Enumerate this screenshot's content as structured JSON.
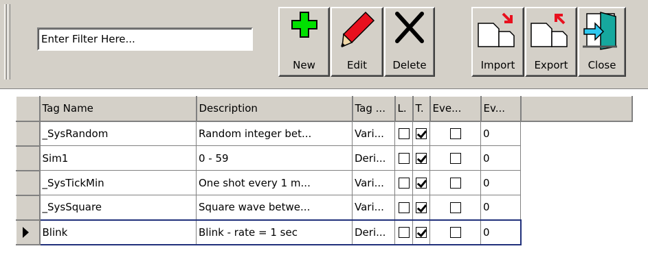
{
  "toolbar": {
    "filter_placeholder": "Enter Filter Here...",
    "buttons": [
      {
        "label": "New",
        "icon": "plus-icon"
      },
      {
        "label": "Edit",
        "icon": "pencil-icon"
      },
      {
        "label": "Delete",
        "icon": "x-icon"
      },
      {
        "label": "Import",
        "icon": "import-icon"
      },
      {
        "label": "Export",
        "icon": "export-icon"
      },
      {
        "label": "Close",
        "icon": "door-icon"
      }
    ]
  },
  "grid": {
    "columns": [
      "Tag Name",
      "Description",
      "Tag ...",
      "L.",
      "T.",
      "Eve...",
      "Ev..."
    ],
    "rows": [
      {
        "name": "_SysRandom",
        "description": "Random integer bet...",
        "tag": "Vari...",
        "l": false,
        "t": true,
        "eve": false,
        "ev": "0"
      },
      {
        "name": "Sim1",
        "description": "0 - 59",
        "tag": "Deri...",
        "l": false,
        "t": true,
        "eve": false,
        "ev": "0"
      },
      {
        "name": "_SysTickMin",
        "description": "One shot every 1 m...",
        "tag": "Vari...",
        "l": false,
        "t": true,
        "eve": false,
        "ev": "0"
      },
      {
        "name": "_SysSquare",
        "description": "Square wave betwe...",
        "tag": "Vari...",
        "l": false,
        "t": true,
        "eve": false,
        "ev": "0"
      },
      {
        "name": "Blink",
        "description": "Blink - rate = 1 sec",
        "tag": "Deri...",
        "l": false,
        "t": true,
        "eve": false,
        "ev": "0"
      }
    ],
    "current_row": 4
  }
}
